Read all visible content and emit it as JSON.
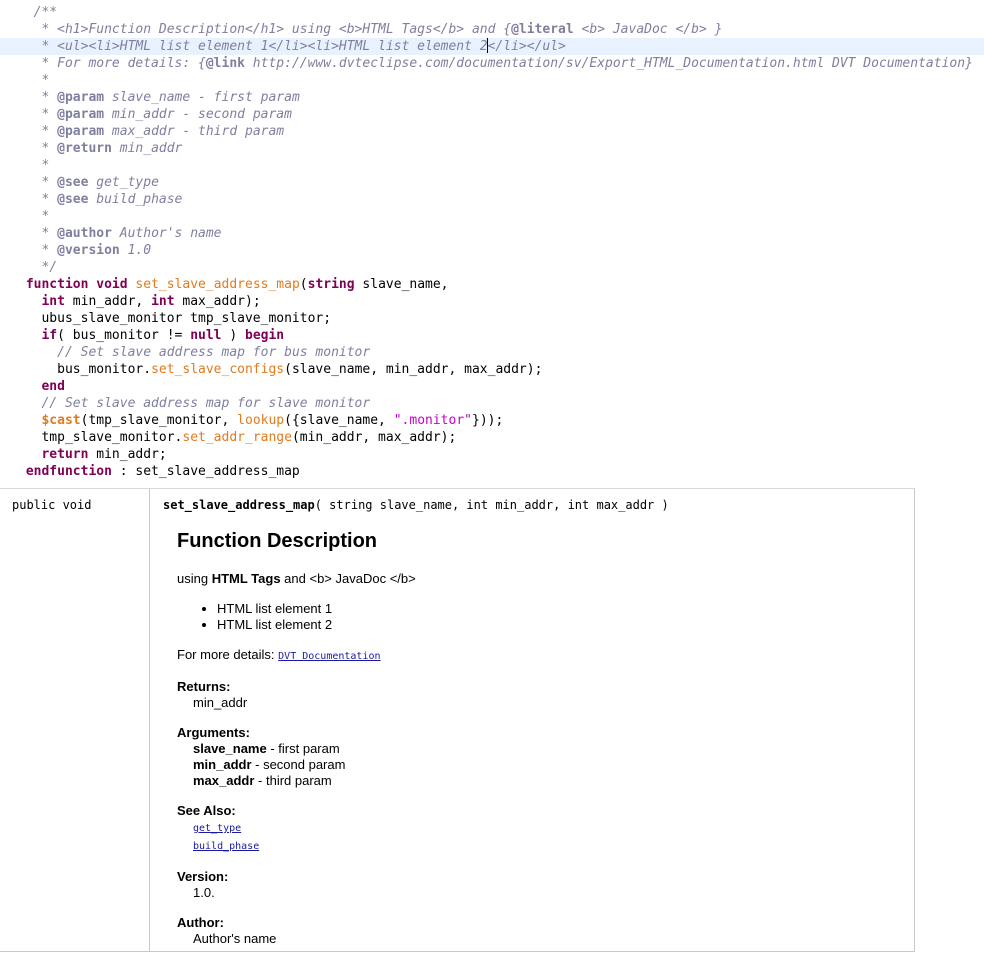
{
  "code": {
    "lines": [
      [
        {
          "c": "tok-doc",
          "t": "  /**"
        }
      ],
      [
        {
          "c": "tok-doc",
          "t": "   * <h1>Function Description</h1> using <b>HTML Tags</b> and {"
        },
        {
          "c": "tok-doctag",
          "t": "@literal"
        },
        {
          "c": "tok-doc",
          "t": " <b> JavaDoc </b> }"
        }
      ],
      [
        {
          "c": "tok-doc",
          "t": "   * <ul><li>HTML list element 1</li><li>HTML list element 2"
        },
        {
          "c": "caret",
          "t": ""
        },
        {
          "c": "tok-doc",
          "t": "</li></ul>"
        }
      ],
      [
        {
          "c": "tok-doc",
          "t": "   * For more details: {"
        },
        {
          "c": "tok-doctag",
          "t": "@link"
        },
        {
          "c": "tok-doc",
          "t": " http://www.dvteclipse.com/documentation/sv/Export_HTML_Documentation.html DVT Documentation}"
        }
      ],
      [
        {
          "c": "tok-doc",
          "t": "   *"
        }
      ],
      [
        {
          "c": "tok-doc",
          "t": "   * "
        },
        {
          "c": "tok-doctag",
          "t": "@param"
        },
        {
          "c": "tok-doc",
          "t": " slave_name - first param"
        }
      ],
      [
        {
          "c": "tok-doc",
          "t": "   * "
        },
        {
          "c": "tok-doctag",
          "t": "@param"
        },
        {
          "c": "tok-doc",
          "t": " min_addr - second param"
        }
      ],
      [
        {
          "c": "tok-doc",
          "t": "   * "
        },
        {
          "c": "tok-doctag",
          "t": "@param"
        },
        {
          "c": "tok-doc",
          "t": " max_addr - third param"
        }
      ],
      [
        {
          "c": "tok-doc",
          "t": "   * "
        },
        {
          "c": "tok-doctag",
          "t": "@return"
        },
        {
          "c": "tok-doc",
          "t": " min_addr"
        }
      ],
      [
        {
          "c": "tok-doc",
          "t": "   *"
        }
      ],
      [
        {
          "c": "tok-doc",
          "t": "   * "
        },
        {
          "c": "tok-doctag",
          "t": "@see"
        },
        {
          "c": "tok-doc",
          "t": " get_type"
        }
      ],
      [
        {
          "c": "tok-doc",
          "t": "   * "
        },
        {
          "c": "tok-doctag",
          "t": "@see"
        },
        {
          "c": "tok-doc",
          "t": " build_phase"
        }
      ],
      [
        {
          "c": "tok-doc",
          "t": "   *"
        }
      ],
      [
        {
          "c": "tok-doc",
          "t": "   * "
        },
        {
          "c": "tok-doctag",
          "t": "@author"
        },
        {
          "c": "tok-doc",
          "t": " Author's name"
        }
      ],
      [
        {
          "c": "tok-doc",
          "t": "   * "
        },
        {
          "c": "tok-doctag",
          "t": "@version"
        },
        {
          "c": "tok-doc",
          "t": " 1.0"
        }
      ],
      [
        {
          "c": "tok-doc",
          "t": "   */"
        }
      ],
      [
        {
          "c": "tok-kw",
          "t": " function"
        },
        {
          "c": "tok-plain",
          "t": " "
        },
        {
          "c": "tok-kw",
          "t": "void"
        },
        {
          "c": "tok-plain",
          "t": " "
        },
        {
          "c": "tok-fn",
          "t": "set_slave_address_map"
        },
        {
          "c": "tok-plain",
          "t": "("
        },
        {
          "c": "tok-kw",
          "t": "string"
        },
        {
          "c": "tok-plain",
          "t": " slave_name,"
        }
      ],
      [
        {
          "c": "tok-plain",
          "t": "   "
        },
        {
          "c": "tok-kw",
          "t": "int"
        },
        {
          "c": "tok-plain",
          "t": " min_addr, "
        },
        {
          "c": "tok-kw",
          "t": "int"
        },
        {
          "c": "tok-plain",
          "t": " max_addr);"
        }
      ],
      [
        {
          "c": "tok-plain",
          "t": "   ubus_slave_monitor tmp_slave_monitor;"
        }
      ],
      [
        {
          "c": "tok-plain",
          "t": "   "
        },
        {
          "c": "tok-kw",
          "t": "if"
        },
        {
          "c": "tok-plain",
          "t": "( bus_monitor != "
        },
        {
          "c": "tok-kw",
          "t": "null"
        },
        {
          "c": "tok-plain",
          "t": " ) "
        },
        {
          "c": "tok-kw",
          "t": "begin"
        }
      ],
      [
        {
          "c": "tok-plain",
          "t": "     "
        },
        {
          "c": "tok-cm",
          "t": "// Set slave address map for bus monitor"
        }
      ],
      [
        {
          "c": "tok-plain",
          "t": "     bus_monitor."
        },
        {
          "c": "tok-fn",
          "t": "set_slave_configs"
        },
        {
          "c": "tok-plain",
          "t": "(slave_name, min_addr, max_addr);"
        }
      ],
      [
        {
          "c": "tok-plain",
          "t": "   "
        },
        {
          "c": "tok-kw",
          "t": "end"
        }
      ],
      [
        {
          "c": "tok-plain",
          "t": "   "
        },
        {
          "c": "tok-cm",
          "t": "// Set slave address map for slave monitor"
        }
      ],
      [
        {
          "c": "tok-plain",
          "t": "   "
        },
        {
          "c": "tok-sys",
          "t": "$cast"
        },
        {
          "c": "tok-plain",
          "t": "(tmp_slave_monitor, "
        },
        {
          "c": "tok-fn",
          "t": "lookup"
        },
        {
          "c": "tok-plain",
          "t": "({slave_name, "
        },
        {
          "c": "tok-str",
          "t": "\".monitor\""
        },
        {
          "c": "tok-plain",
          "t": "}));"
        }
      ],
      [
        {
          "c": "tok-plain",
          "t": "   tmp_slave_monitor."
        },
        {
          "c": "tok-fn",
          "t": "set_addr_range"
        },
        {
          "c": "tok-plain",
          "t": "(min_addr, max_addr);"
        }
      ],
      [
        {
          "c": "tok-plain",
          "t": "   "
        },
        {
          "c": "tok-kw",
          "t": "return"
        },
        {
          "c": "tok-plain",
          "t": " min_addr;"
        }
      ],
      [
        {
          "c": "tok-kw",
          "t": " endfunction"
        },
        {
          "c": "tok-plain",
          "t": " : set_slave_address_map"
        }
      ]
    ],
    "current_line_index": 2
  },
  "doc": {
    "modifiers": "public void",
    "signature_name": "set_slave_address_map",
    "signature_params": "( string slave_name, int min_addr, int max_addr )",
    "heading": "Function Description",
    "intro_prefix": "using ",
    "intro_bold": "HTML Tags",
    "intro_suffix": " and <b> JavaDoc </b>",
    "list": [
      "HTML list element 1",
      "HTML list element 2"
    ],
    "more_details_prefix": "For more details: ",
    "more_details_link": "DVT Documentation",
    "returns_title": "Returns:",
    "returns_value": "min_addr",
    "arguments_title": "Arguments:",
    "arguments": [
      {
        "name": "slave_name",
        "desc": " - first param"
      },
      {
        "name": "min_addr",
        "desc": " - second param"
      },
      {
        "name": "max_addr",
        "desc": " - third param"
      }
    ],
    "see_also_title": "See Also:",
    "see_also": [
      "get_type",
      "build_phase"
    ],
    "version_title": "Version:",
    "version_value": "1.0.",
    "author_title": "Author:",
    "author_value": "Author's name"
  }
}
